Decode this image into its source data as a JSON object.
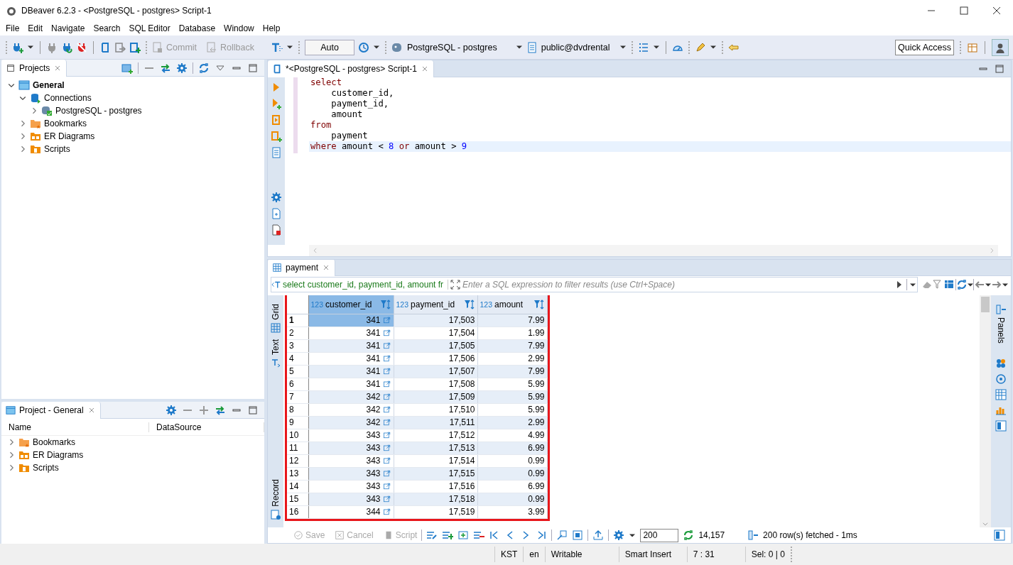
{
  "window": {
    "title": "DBeaver 6.2.3 - <PostgreSQL - postgres> Script-1"
  },
  "menu": [
    "File",
    "Edit",
    "Navigate",
    "Search",
    "SQL Editor",
    "Database",
    "Window",
    "Help"
  ],
  "toolbar": {
    "commit": "Commit",
    "rollback": "Rollback",
    "transaction_mode": "Auto",
    "connection": "PostgreSQL - postgres",
    "schema": "public@dvdrental",
    "quick_access": "Quick Access"
  },
  "projects_panel": {
    "title": "Projects",
    "tree": [
      {
        "label": "General",
        "kind": "project",
        "expanded": true,
        "children": [
          {
            "label": "Connections",
            "kind": "connections",
            "expanded": true,
            "children": [
              {
                "label": "PostgreSQL - postgres",
                "kind": "connection",
                "expanded": false
              }
            ]
          },
          {
            "label": "Bookmarks",
            "kind": "bookmarks",
            "expanded": false
          },
          {
            "label": "ER Diagrams",
            "kind": "diagrams",
            "expanded": false
          },
          {
            "label": "Scripts",
            "kind": "scripts",
            "expanded": false
          }
        ]
      }
    ]
  },
  "project_general_panel": {
    "title": "Project - General",
    "columns": [
      "Name",
      "DataSource"
    ],
    "items": [
      {
        "label": "Bookmarks",
        "kind": "bookmarks",
        "expanded": false
      },
      {
        "label": "ER Diagrams",
        "kind": "diagrams",
        "expanded": false
      },
      {
        "label": "Scripts",
        "kind": "scripts",
        "expanded": false
      }
    ]
  },
  "editor": {
    "tab": "*<PostgreSQL - postgres> Script-1",
    "lines": [
      {
        "current": false,
        "tokens": [
          {
            "kind": "keyword",
            "text": "select"
          }
        ]
      },
      {
        "current": false,
        "tokens": [
          {
            "kind": "ident",
            "text": "    customer_id,"
          }
        ]
      },
      {
        "current": false,
        "tokens": [
          {
            "kind": "ident",
            "text": "    payment_id,"
          }
        ]
      },
      {
        "current": false,
        "tokens": [
          {
            "kind": "ident",
            "text": "    amount"
          }
        ]
      },
      {
        "current": false,
        "tokens": [
          {
            "kind": "keyword",
            "text": "from"
          }
        ]
      },
      {
        "current": false,
        "tokens": [
          {
            "kind": "ident",
            "text": "    payment"
          }
        ]
      },
      {
        "current": true,
        "tokens": [
          {
            "kind": "keyword",
            "text": "where"
          },
          {
            "kind": "ident",
            "text": " amount "
          },
          {
            "kind": "operator",
            "text": "< "
          },
          {
            "kind": "number",
            "text": "8"
          },
          {
            "kind": "keyword",
            "text": " or"
          },
          {
            "kind": "ident",
            "text": " amount "
          },
          {
            "kind": "operator",
            "text": "> "
          },
          {
            "kind": "number",
            "text": "9"
          }
        ]
      }
    ]
  },
  "results": {
    "tab": "payment",
    "query": "select customer_id, payment_id, amount fr",
    "filter_placeholder": "Enter a SQL expression to filter results (use Ctrl+Space)",
    "side_tabs": [
      "Grid",
      "Text",
      "Record"
    ],
    "panels_label": "Panels",
    "columns": [
      {
        "type": "123",
        "name": "customer_id",
        "selected": true,
        "linked": true
      },
      {
        "type": "123",
        "name": "payment_id",
        "selected": false,
        "linked": false
      },
      {
        "type": "123",
        "name": "amount",
        "selected": false,
        "linked": false
      }
    ],
    "rows": [
      {
        "num": "1",
        "selected": true,
        "cells": [
          "341",
          "17,503",
          "7.99"
        ]
      },
      {
        "num": "2",
        "selected": false,
        "cells": [
          "341",
          "17,504",
          "1.99"
        ]
      },
      {
        "num": "3",
        "selected": false,
        "cells": [
          "341",
          "17,505",
          "7.99"
        ]
      },
      {
        "num": "4",
        "selected": false,
        "cells": [
          "341",
          "17,506",
          "2.99"
        ]
      },
      {
        "num": "5",
        "selected": false,
        "cells": [
          "341",
          "17,507",
          "7.99"
        ]
      },
      {
        "num": "6",
        "selected": false,
        "cells": [
          "341",
          "17,508",
          "5.99"
        ]
      },
      {
        "num": "7",
        "selected": false,
        "cells": [
          "342",
          "17,509",
          "5.99"
        ]
      },
      {
        "num": "8",
        "selected": false,
        "cells": [
          "342",
          "17,510",
          "5.99"
        ]
      },
      {
        "num": "9",
        "selected": false,
        "cells": [
          "342",
          "17,511",
          "2.99"
        ]
      },
      {
        "num": "10",
        "selected": false,
        "cells": [
          "343",
          "17,512",
          "4.99"
        ]
      },
      {
        "num": "11",
        "selected": false,
        "cells": [
          "343",
          "17,513",
          "6.99"
        ]
      },
      {
        "num": "12",
        "selected": false,
        "cells": [
          "343",
          "17,514",
          "0.99"
        ]
      },
      {
        "num": "13",
        "selected": false,
        "cells": [
          "343",
          "17,515",
          "0.99"
        ]
      },
      {
        "num": "14",
        "selected": false,
        "cells": [
          "343",
          "17,516",
          "6.99"
        ]
      },
      {
        "num": "15",
        "selected": false,
        "cells": [
          "343",
          "17,518",
          "0.99"
        ]
      },
      {
        "num": "16",
        "selected": false,
        "cells": [
          "344",
          "17,519",
          "3.99"
        ]
      }
    ],
    "save": "Save",
    "cancel": "Cancel",
    "script": "Script",
    "fetch_size": "200",
    "row_count": "14,157",
    "fetch_status": "200 row(s) fetched - 1ms"
  },
  "status_bar": [
    "KST",
    "en",
    "Writable",
    "Smart Insert",
    "7 : 31",
    "Sel: 0 | 0"
  ]
}
